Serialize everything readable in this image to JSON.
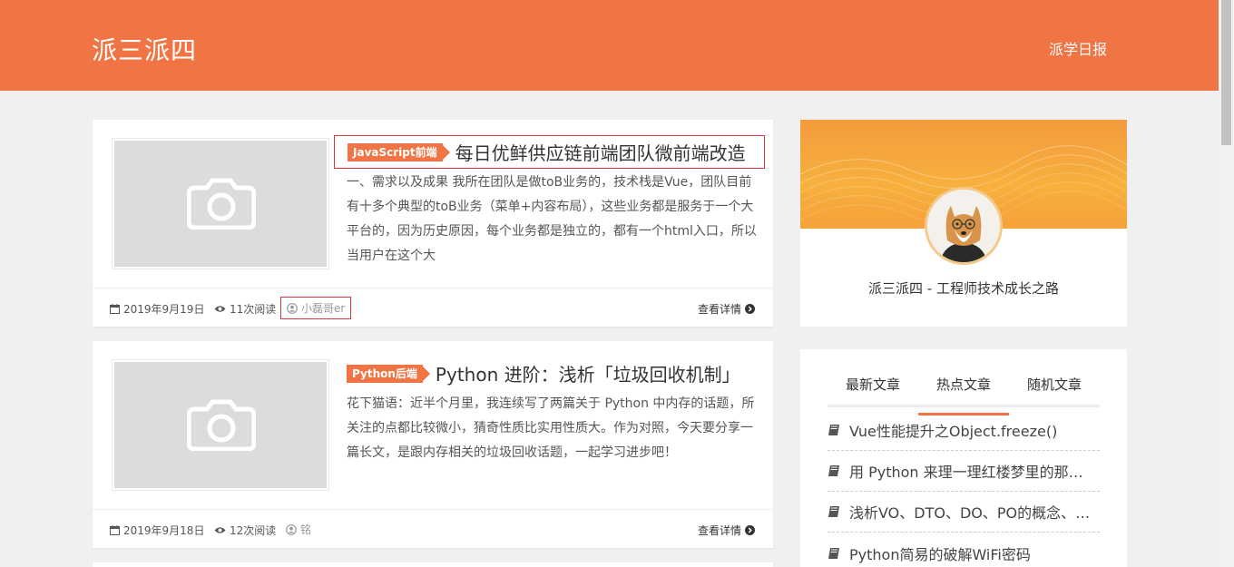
{
  "header": {
    "site_title": "派三派四",
    "nav_link": "派学日报"
  },
  "posts": [
    {
      "tag": "JavaScript前端",
      "title": "每日优鲜供应链前端团队微前端改造",
      "excerpt": "一、需求以及成果 我所在团队是做toB业务的，技术栈是Vue，团队目前有十多个典型的toB业务（菜单+内容布局），这些业务都是服务于一个大平台的，因为历史原因，每个业务都是独立的，都有一个html入口，所以当用户在这个大",
      "date": "2019年9月19日",
      "views": "11次阅读",
      "author": "小磊哥er",
      "read_more": "查看详情"
    },
    {
      "tag": "Python后端",
      "title": "Python 进阶：浅析「垃圾回收机制」",
      "excerpt": "花下猫语：近半个月里，我连续写了两篇关于 Python 中内存的话题，所关注的点都比较微小，猜奇性质比实用性质大。作为对照，今天要分享一篇长文，是跟内存相关的垃圾回收话题，一起学习进步吧！",
      "date": "2019年9月18日",
      "views": "12次阅读",
      "author": "铭",
      "read_more": "查看详情"
    }
  ],
  "profile": {
    "name": "派三派四 - 工程师技术成长之路"
  },
  "widget": {
    "tabs": [
      "最新文章",
      "热点文章",
      "随机文章"
    ],
    "active_tab": "热点文章",
    "items": [
      "Vue性能提升之Object.freeze()",
      "用 Python 来理一理红楼梦里的那些关系",
      "浅析VO、DTO、DO、PO的概念、区别和用处",
      "Python简易的破解WiFi密码"
    ]
  },
  "colors": {
    "accent": "#f07444",
    "highlight_border": "#d9363e"
  }
}
